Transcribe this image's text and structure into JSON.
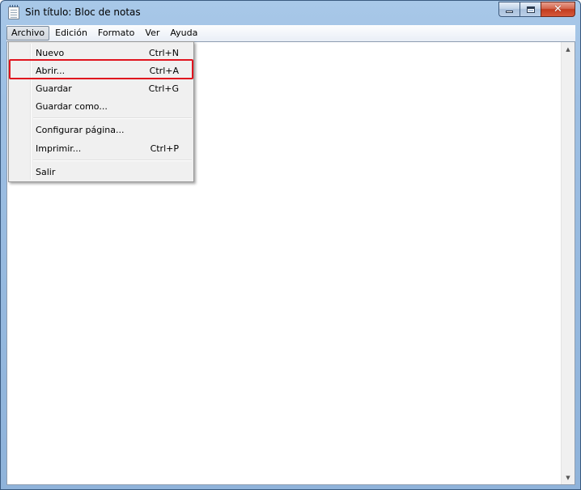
{
  "window": {
    "title": "Sin título: Bloc de notas",
    "close_glyph": "✕"
  },
  "menubar": {
    "items": [
      {
        "label": "Archivo",
        "open": true
      },
      {
        "label": "Edición"
      },
      {
        "label": "Formato"
      },
      {
        "label": "Ver"
      },
      {
        "label": "Ayuda"
      }
    ]
  },
  "file_menu": {
    "items": [
      {
        "label": "Nuevo",
        "shortcut": "Ctrl+N"
      },
      {
        "label": "Abrir...",
        "shortcut": "Ctrl+A",
        "highlighted": true
      },
      {
        "label": "Guardar",
        "shortcut": "Ctrl+G"
      },
      {
        "label": "Guardar como...",
        "shortcut": ""
      },
      {
        "label": "Configurar página...",
        "shortcut": ""
      },
      {
        "label": "Imprimir...",
        "shortcut": "Ctrl+P"
      },
      {
        "label": "Salir",
        "shortcut": ""
      }
    ]
  },
  "scrollbar": {
    "up_glyph": "▲",
    "down_glyph": "▼"
  },
  "colors": {
    "highlight_border": "#e0141e",
    "titlebar": "#9dbfe3",
    "close_button": "#c23c1f"
  }
}
